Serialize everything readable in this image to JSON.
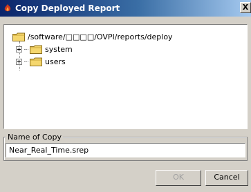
{
  "window": {
    "title": "Copy Deployed Report",
    "close_label": "X"
  },
  "tree": {
    "root_path": "/software/□□□□/OVPI/reports/deploy",
    "children": [
      {
        "label": "system"
      },
      {
        "label": "users"
      }
    ]
  },
  "name_group": {
    "label": "Name of Copy",
    "value": "Near_Real_Time.srep"
  },
  "buttons": {
    "ok": "OK",
    "cancel": "Cancel",
    "ok_enabled": false
  },
  "colors": {
    "titlebar_start": "#0a246a",
    "titlebar_end": "#a6caf0",
    "dialog_bg": "#d4d0c8",
    "folder_yellow": "#f5d76e"
  }
}
